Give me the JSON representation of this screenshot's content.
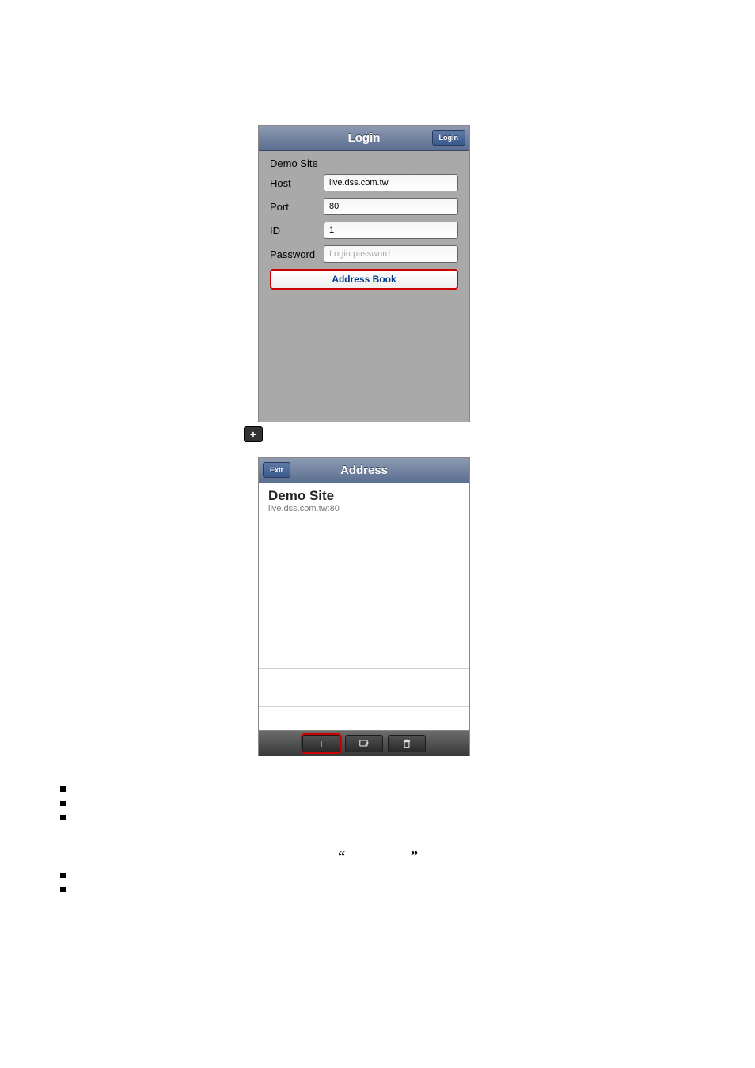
{
  "login_screen": {
    "title": "Login",
    "login_button": "Login",
    "site_name": "Demo Site",
    "rows": {
      "host": {
        "label": "Host",
        "value": "live.dss.com.tw"
      },
      "port": {
        "label": "Port",
        "value": "80"
      },
      "id": {
        "label": "ID",
        "value": "1"
      },
      "password": {
        "label": "Password",
        "placeholder": "Login password"
      }
    },
    "address_book_label": "Address Book"
  },
  "plus_icon": "+",
  "address_screen": {
    "title": "Address",
    "exit_button": "Exit",
    "entry": {
      "name": "Demo Site",
      "host": "live.dss.com.tw:80"
    },
    "toolbar": {
      "add": "+",
      "edit": "edit",
      "delete": "trash"
    }
  },
  "quotes": {
    "open": "“",
    "close": "”"
  }
}
